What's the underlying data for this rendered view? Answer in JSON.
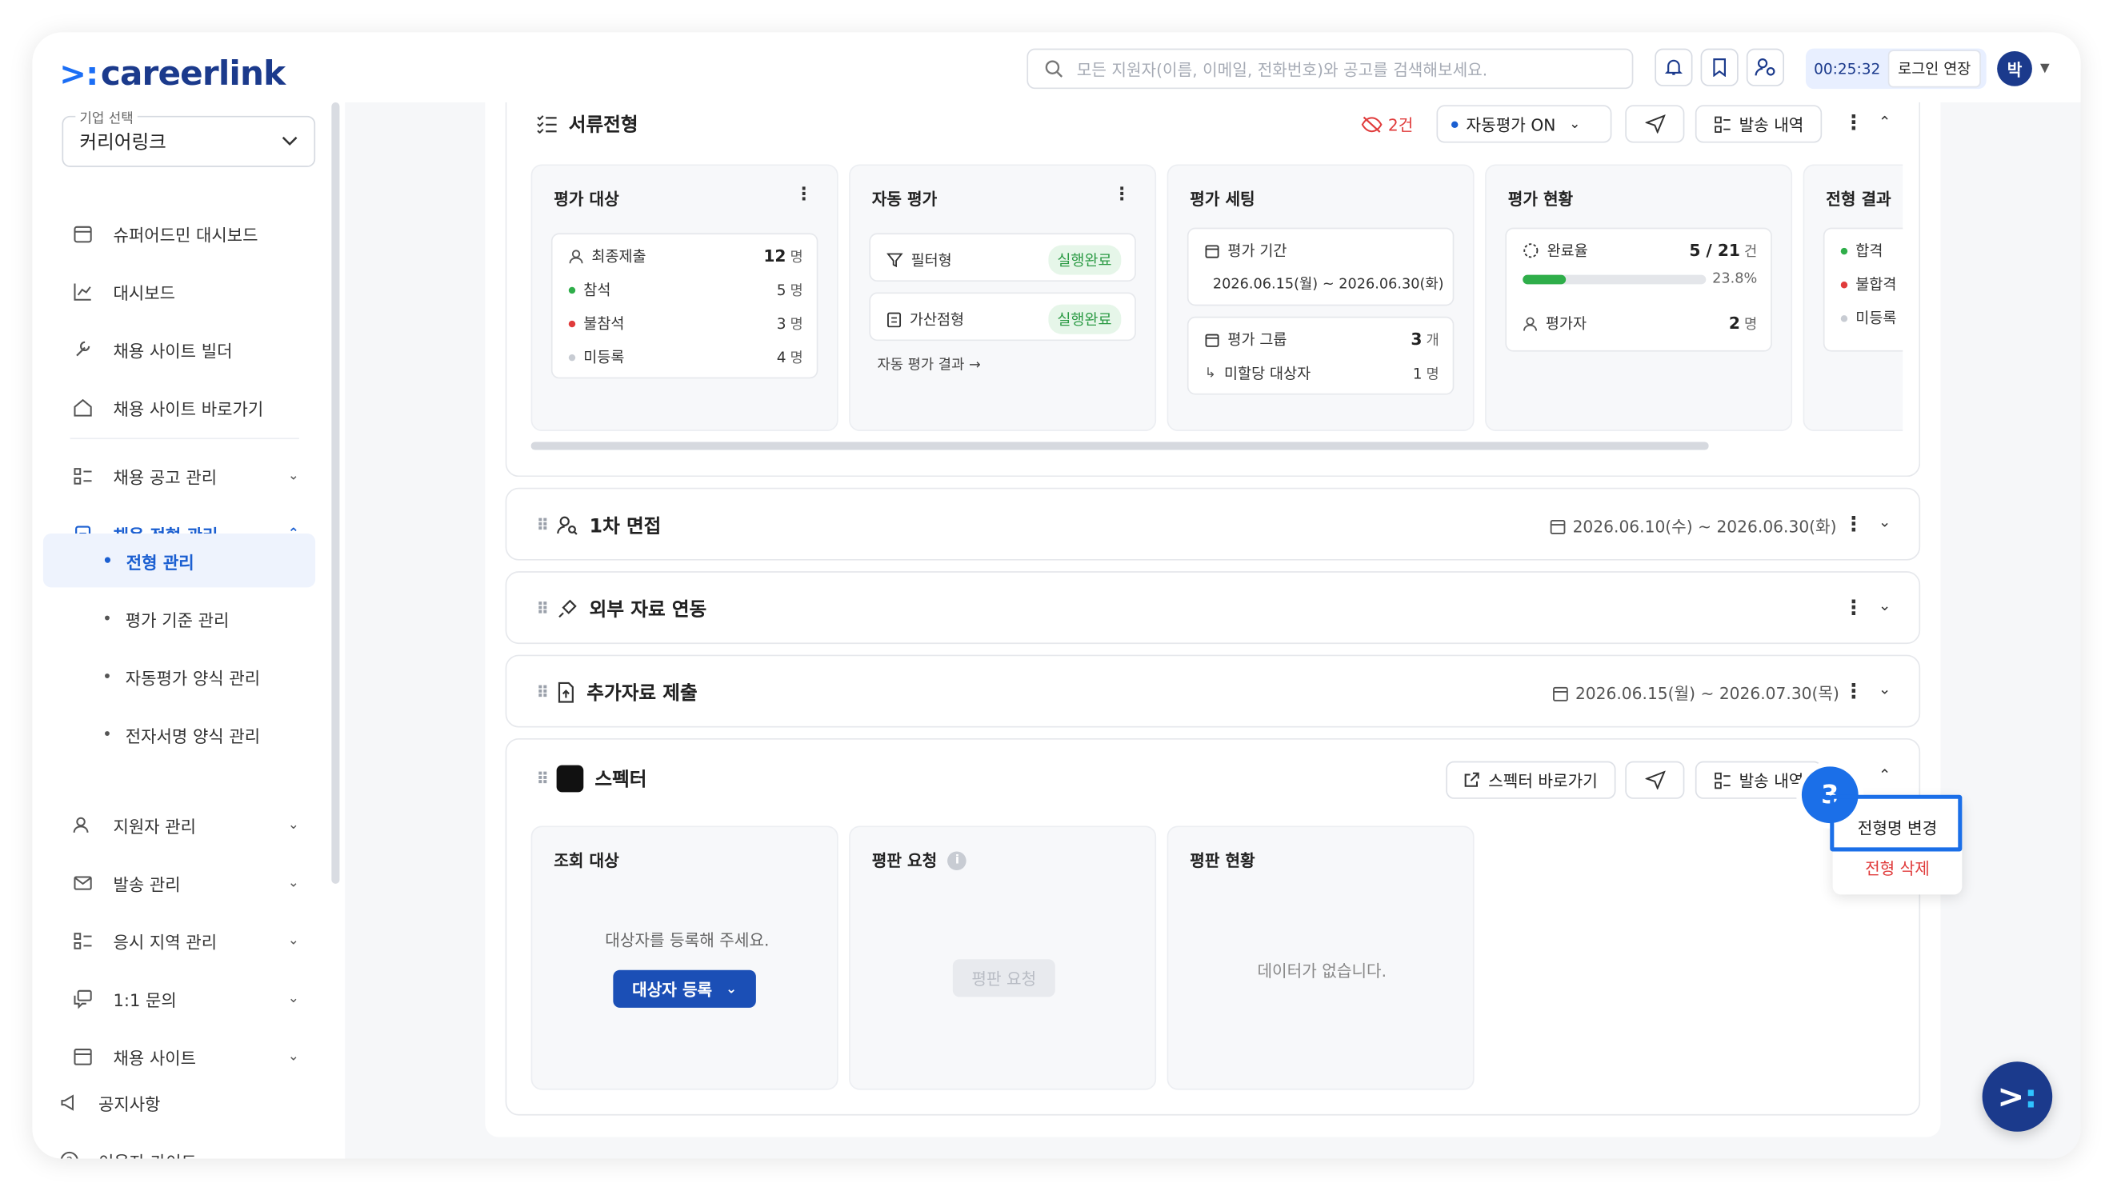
{
  "app": {
    "logo_text": "careerlink",
    "search_placeholder": "모든 지원자(이름, 이메일, 전화번호)와 공고를 검색해보세요.",
    "timer": "00:25:32",
    "extend_login": "로그인 연장",
    "avatar": "박"
  },
  "sidebar": {
    "company_label": "기업 선택",
    "company_value": "커리어링크",
    "items": {
      "superadmin": "슈퍼어드민 대시보드",
      "dashboard": "대시보드",
      "site_builder": "채용 사이트 빌더",
      "site_shortcut": "채용 사이트 바로가기",
      "job_posts": "채용 공고 관리",
      "process_mgmt": "채용 전형 관리",
      "applicants": "지원자 관리",
      "dispatch": "발송 관리",
      "regions": "응시 지역 관리",
      "inquiry": "1:1 문의",
      "careers_site": "채용 사이트"
    },
    "sub_items": {
      "process": "전형 관리",
      "criteria": "평가 기준 관리",
      "auto_eval": "자동평가 양식 관리",
      "esign": "전자서명 양식 관리"
    },
    "bottom": {
      "notice": "공지사항",
      "guide": "이용자 가이드"
    }
  },
  "doc_stage": {
    "title": "서류전형",
    "hidden_count": "2건",
    "auto_eval_toggle": "자동평가 ON",
    "history": "발송 내역",
    "panels": {
      "target": {
        "title": "평가 대상",
        "rows": [
          {
            "label": "최종제출",
            "value": "12",
            "unit": "명"
          },
          {
            "label": "참석",
            "value": "5",
            "unit": "명"
          },
          {
            "label": "불참석",
            "value": "3",
            "unit": "명"
          },
          {
            "label": "미등록",
            "value": "4",
            "unit": "명"
          }
        ]
      },
      "auto": {
        "title": "자동 평가",
        "filter": "필터형",
        "score": "가산점형",
        "status": "실행완료",
        "result_link": "자동 평가 결과 →"
      },
      "setting": {
        "title": "평가 세팅",
        "period_label": "평가 기간",
        "period_value": "2026.06.15(월) ~ 2026.06.30(화)",
        "group_label": "평가 그룹",
        "group_value": "3",
        "group_unit": "개",
        "unassigned_label": "미할당 대상자",
        "unassigned_value": "1",
        "unassigned_unit": "명"
      },
      "status": {
        "title": "평가 현황",
        "completion_label": "완료율",
        "completion_value": "5 / 21",
        "completion_unit": "건",
        "completion_percent": "23.8%",
        "completion_fraction": 0.238,
        "evaluator_label": "평가자",
        "evaluator_value": "2",
        "evaluator_unit": "명"
      },
      "result": {
        "title": "전형 결과",
        "pass": "합격",
        "fail": "불합격",
        "unregistered": "미등록"
      }
    }
  },
  "stages": {
    "interview": {
      "title": "1차 면접",
      "dates": "2026.06.10(수) ~ 2026.06.30(화)"
    },
    "external": {
      "title": "외부 자료 연동"
    },
    "extra_docs": {
      "title": "추가자료 제출",
      "dates": "2026.06.15(월) ~ 2026.07.30(목)"
    }
  },
  "spectre": {
    "title": "스펙터",
    "goto": "스펙터 바로가기",
    "history": "발송 내역",
    "lookup_title": "조회 대상",
    "lookup_empty": "대상자를 등록해 주세요.",
    "register_btn": "대상자 등록",
    "request_title": "평판 요청",
    "request_btn": "평판 요청",
    "status_title": "평판 현황",
    "status_empty": "데이터가 없습니다."
  },
  "context_menu": {
    "rename": "전형명 변경",
    "delete": "전형 삭제"
  },
  "step_badge": "3",
  "colors": {
    "brand": "#1b3a8c",
    "accent": "#1b6fe8",
    "success": "#2fae4a",
    "danger": "#e03b3b"
  }
}
